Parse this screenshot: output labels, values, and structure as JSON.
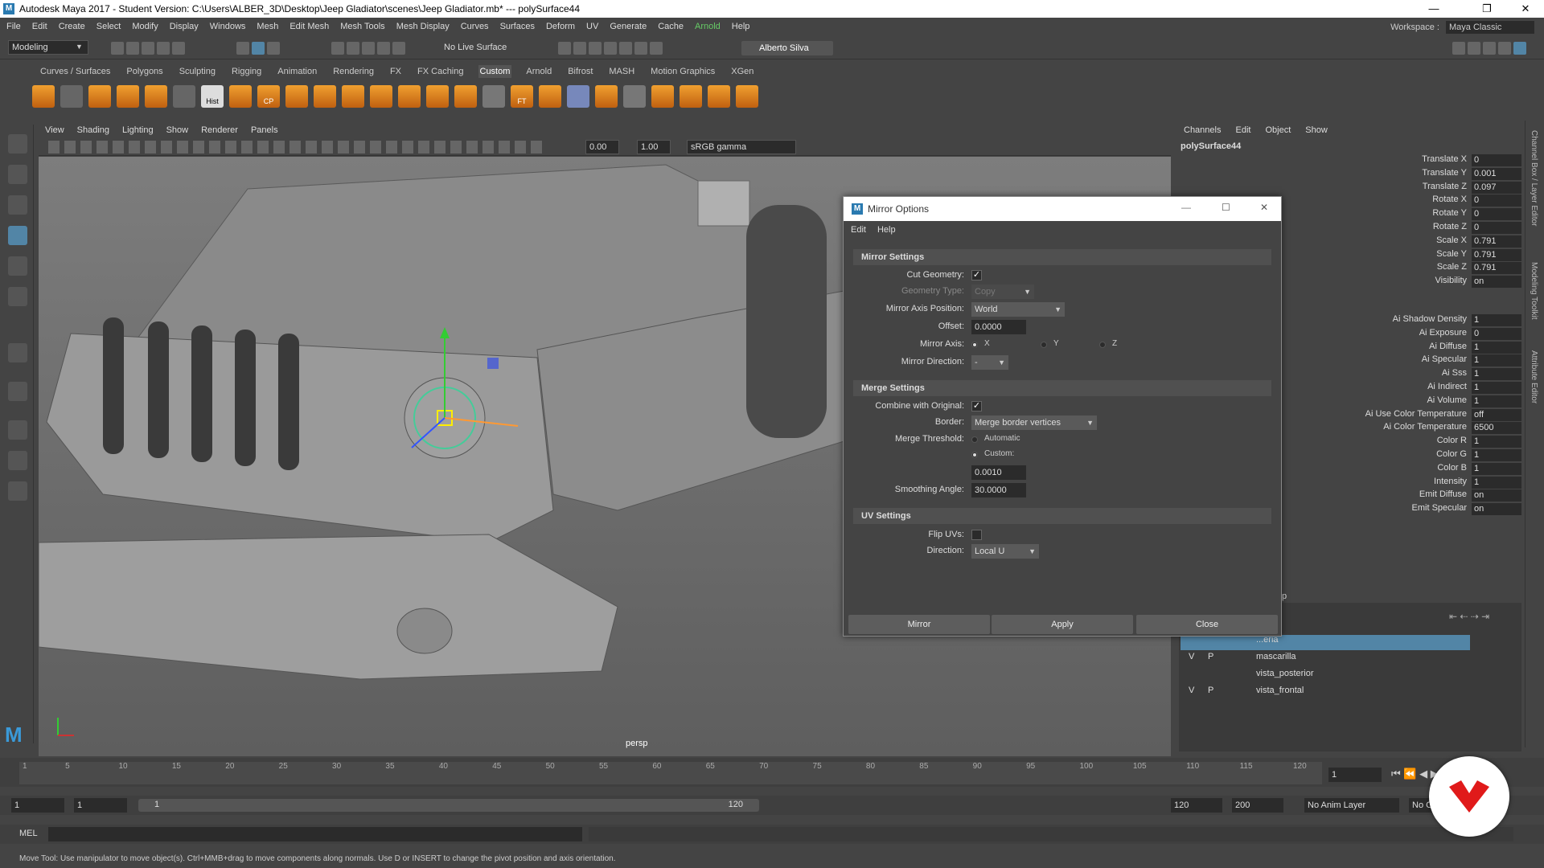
{
  "window": {
    "title": "Autodesk Maya 2017 - Student Version: C:\\Users\\ALBER_3D\\Desktop\\Jeep Gladiator\\scenes\\Jeep Gladiator.mb*   ---   polySurface44",
    "logo": "M",
    "minimize": "—",
    "restore": "❐",
    "close": "✕"
  },
  "menubar": [
    "File",
    "Edit",
    "Create",
    "Select",
    "Modify",
    "Display",
    "Windows",
    "Mesh",
    "Edit Mesh",
    "Mesh Tools",
    "Mesh Display",
    "Curves",
    "Surfaces",
    "Deform",
    "UV",
    "Generate",
    "Cache",
    "Arnold",
    "Help"
  ],
  "workspace": {
    "label": "Workspace :",
    "value": "Maya Classic"
  },
  "statusline": {
    "mode": "Modeling",
    "live_surface": "No Live Surface",
    "user": "Alberto Silva"
  },
  "shelf_tabs": [
    "Curves / Surfaces",
    "Polygons",
    "Sculpting",
    "Rigging",
    "Animation",
    "Rendering",
    "FX",
    "FX Caching",
    "Custom",
    "Arnold",
    "Bifrost",
    "MASH",
    "Motion Graphics",
    "XGen"
  ],
  "shelf_active": "Custom",
  "shelf_labels": {
    "hist": "Hist",
    "cp": "CP",
    "ft": "FT"
  },
  "viewport": {
    "menu": [
      "View",
      "Shading",
      "Lighting",
      "Show",
      "Renderer",
      "Panels"
    ],
    "field1": "0.00",
    "field2": "1.00",
    "colorspace": "sRGB gamma",
    "camera": "persp"
  },
  "channelbox": {
    "menu": [
      "Channels",
      "Edit",
      "Object",
      "Show"
    ],
    "object": "polySurface44",
    "transform": [
      {
        "name": "Translate X",
        "value": "0"
      },
      {
        "name": "Translate Y",
        "value": "0.001"
      },
      {
        "name": "Translate Z",
        "value": "0.097"
      },
      {
        "name": "Rotate X",
        "value": "0"
      },
      {
        "name": "Rotate Y",
        "value": "0"
      },
      {
        "name": "Rotate Z",
        "value": "0"
      },
      {
        "name": "Scale X",
        "value": "0.791"
      },
      {
        "name": "Scale Y",
        "value": "0.791"
      },
      {
        "name": "Scale Z",
        "value": "0.791"
      },
      {
        "name": "Visibility",
        "value": "on"
      }
    ],
    "arnold": [
      {
        "name": "Ai Shadow Density",
        "value": "1"
      },
      {
        "name": "Ai Exposure",
        "value": "0"
      },
      {
        "name": "Ai Diffuse",
        "value": "1"
      },
      {
        "name": "Ai Specular",
        "value": "1"
      },
      {
        "name": "Ai Sss",
        "value": "1"
      },
      {
        "name": "Ai Indirect",
        "value": "1"
      },
      {
        "name": "Ai Volume",
        "value": "1"
      },
      {
        "name": "Ai Use Color Temperature",
        "value": "off"
      },
      {
        "name": "Ai Color Temperature",
        "value": "6500"
      },
      {
        "name": "Color R",
        "value": "1"
      },
      {
        "name": "Color G",
        "value": "1"
      },
      {
        "name": "Color B",
        "value": "1"
      },
      {
        "name": "Intensity",
        "value": "1"
      },
      {
        "name": "Emit Diffuse",
        "value": "on"
      },
      {
        "name": "Emit Specular",
        "value": "on"
      }
    ]
  },
  "side_tabs": [
    "Channel Box / Layer Editor",
    "Modeling Toolkit",
    "Attribute Editor"
  ],
  "layers": {
    "partial_label": "p",
    "rows": [
      {
        "v": "",
        "p": "",
        "name": "...eria"
      },
      {
        "v": "V",
        "p": "P",
        "name": "mascarilla"
      },
      {
        "v": "",
        "p": "",
        "name": "vista_posterior"
      },
      {
        "v": "V",
        "p": "P",
        "name": "vista_frontal"
      }
    ]
  },
  "timeline": {
    "ticks": [
      "1",
      "5",
      "10",
      "15",
      "20",
      "25",
      "30",
      "35",
      "40",
      "45",
      "50",
      "55",
      "60",
      "65",
      "70",
      "75",
      "80",
      "85",
      "90",
      "95",
      "100",
      "105",
      "110",
      "115",
      "120"
    ],
    "current": "1"
  },
  "range": {
    "start": "1",
    "playback_start": "1",
    "range_start": "1",
    "range_end": "120",
    "playback_end": "120",
    "end": "200",
    "anim_layer": "No Anim Layer",
    "char_set": "No C"
  },
  "cmdline": {
    "label": "MEL"
  },
  "helpline": "Move Tool: Use manipulator to move object(s). Ctrl+MMB+drag to move components along normals. Use D or INSERT to change the pivot position and axis orientation.",
  "dialog": {
    "title": "Mirror Options",
    "menu": [
      "Edit",
      "Help"
    ],
    "mirror_settings": {
      "header": "Mirror Settings",
      "cut_geometry_label": "Cut Geometry:",
      "cut_geometry_check": "✓",
      "geometry_type_label": "Geometry Type:",
      "geometry_type_value": "Copy",
      "axis_position_label": "Mirror Axis Position:",
      "axis_position_value": "World",
      "offset_label": "Offset:",
      "offset_value": "0.0000",
      "mirror_axis_label": "Mirror Axis:",
      "axis_x": "X",
      "axis_y": "Y",
      "axis_z": "Z",
      "direction_label": "Mirror Direction:",
      "direction_value": "-"
    },
    "merge_settings": {
      "header": "Merge Settings",
      "combine_label": "Combine with Original:",
      "combine_check": "✓",
      "border_label": "Border:",
      "border_value": "Merge border vertices",
      "threshold_label": "Merge Threshold:",
      "automatic": "Automatic",
      "custom": "Custom:",
      "threshold_value": "0.0010",
      "smoothing_label": "Smoothing Angle:",
      "smoothing_value": "30.0000"
    },
    "uv_settings": {
      "header": "UV Settings",
      "flip_label": "Flip UVs:",
      "direction_label": "Direction:",
      "direction_value": "Local U"
    },
    "buttons": {
      "mirror": "Mirror",
      "apply": "Apply",
      "close": "Close"
    }
  }
}
